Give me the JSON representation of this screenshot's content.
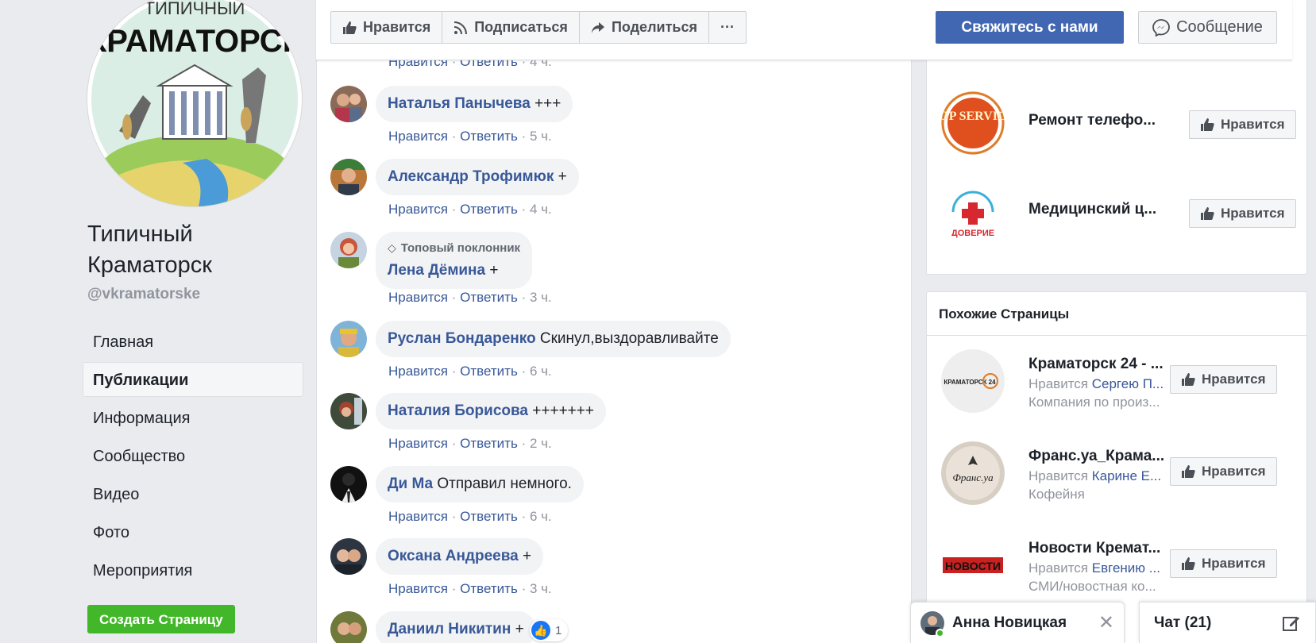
{
  "page": {
    "name": "Типичный Краматорск",
    "handle": "@vkramatorske",
    "logo_top": "ТИПИЧНЫЙ",
    "logo_main": "КРАМАТОРСК"
  },
  "nav": [
    "Главная",
    "Публикации",
    "Информация",
    "Сообщество",
    "Видео",
    "Фото",
    "Мероприятия"
  ],
  "create_page_label": "Создать Страницу",
  "action_bar": {
    "like": "Нравится",
    "follow": "Подписаться",
    "share": "Поделиться",
    "more": "···",
    "contact": "Свяжитесь с нами",
    "message": "Сообщение"
  },
  "top_meta": {
    "like": "Нравится",
    "reply": "Ответить",
    "time": "4 ч."
  },
  "comments": [
    {
      "author": "Наталья Панычева",
      "text": "+++",
      "time": "5 ч."
    },
    {
      "author": "Александр Трофимюк",
      "text": "+",
      "time": "4 ч."
    },
    {
      "badge": "Топовый поклонник",
      "author": "Лена Дёмина",
      "text": "+",
      "time": "3 ч."
    },
    {
      "author": "Руслан Бондаренко",
      "text": "Скинул,выздоравливайте",
      "time": "6 ч."
    },
    {
      "author": "Наталия Борисова",
      "text": "+++++++",
      "time": "2 ч."
    },
    {
      "author": "Ди Ма",
      "text": "Отправил немного.",
      "time": "6 ч."
    },
    {
      "author": "Оксана Андреева",
      "text": "+",
      "time": "3 ч."
    },
    {
      "author": "Даниил Никитин",
      "text": "+",
      "time": ""
    }
  ],
  "meta_labels": {
    "like": "Нравится",
    "reply": "Ответить",
    "sep": "·"
  },
  "reaction_count": "1",
  "top_pages": [
    {
      "name": "Ремонт телефо...",
      "like": "Нравится",
      "logo": "TOP SERVICE"
    },
    {
      "name": "Медицинский ц...",
      "like": "Нравится",
      "logo": "ДОВЕРИЕ"
    }
  ],
  "similar": {
    "title": "Похожие Страницы",
    "pages": [
      {
        "name": "Краматорск 24 - ...",
        "liked_prefix": "Нравится",
        "friend": "Сергею П...",
        "category": "Компания по произ...",
        "like": "Нравится",
        "logo": "КРАМАТОРСК 24"
      },
      {
        "name": "Франс.уа_Крама...",
        "liked_prefix": "Нравится",
        "friend": "Карине Е...",
        "category": "Кофейня",
        "like": "Нравится",
        "logo": "Франс.уа"
      },
      {
        "name": "Новости Кремат...",
        "liked_prefix": "Нравится",
        "friend": "Евгению ...",
        "category": "СМИ/новостная ко...",
        "like": "Нравится",
        "logo": "НОВОСТИ"
      }
    ]
  },
  "chat": {
    "contact_name": "Анна Новицкая",
    "main_label": "Чат (21)"
  },
  "colors": {
    "fb_blue": "#4267b2",
    "link": "#385898",
    "green": "#42b72a",
    "bg": "#e9ebee"
  }
}
